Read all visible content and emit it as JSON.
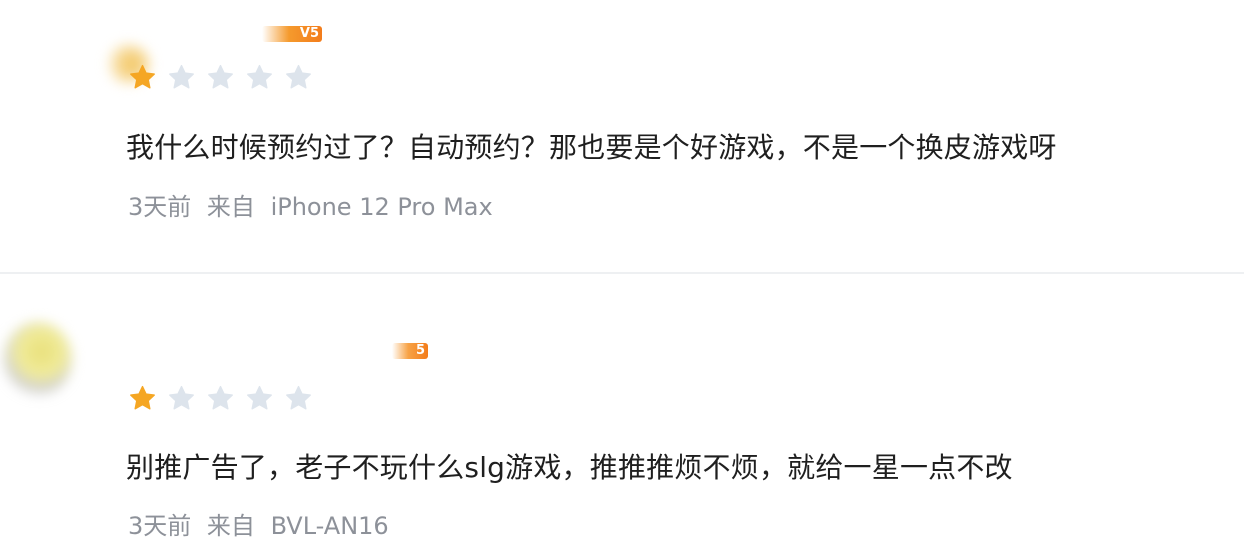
{
  "reviews": [
    {
      "level_badge": "V5",
      "rating": 1,
      "max_rating": 5,
      "comment": "我什么时候预约过了？自动预约？那也要是个好游戏，不是一个换皮游戏呀",
      "time": "3天前",
      "source_prefix": "来自",
      "device": "iPhone 12 Pro Max"
    },
    {
      "level_badge": "5",
      "rating": 1,
      "max_rating": 5,
      "comment": "别推广告了，老子不玩什么slg游戏，推推推烦不烦，就给一星一点不改",
      "time": "3天前",
      "source_prefix": "来自",
      "device": "BVL-AN16"
    }
  ],
  "colors": {
    "star_filled": "#f5a623",
    "star_empty": "#dde4ec",
    "text": "#1f1f1f",
    "meta_text": "#8d9199"
  },
  "icons": {
    "star_filled": "star-filled-icon",
    "star_empty": "star-empty-icon"
  }
}
